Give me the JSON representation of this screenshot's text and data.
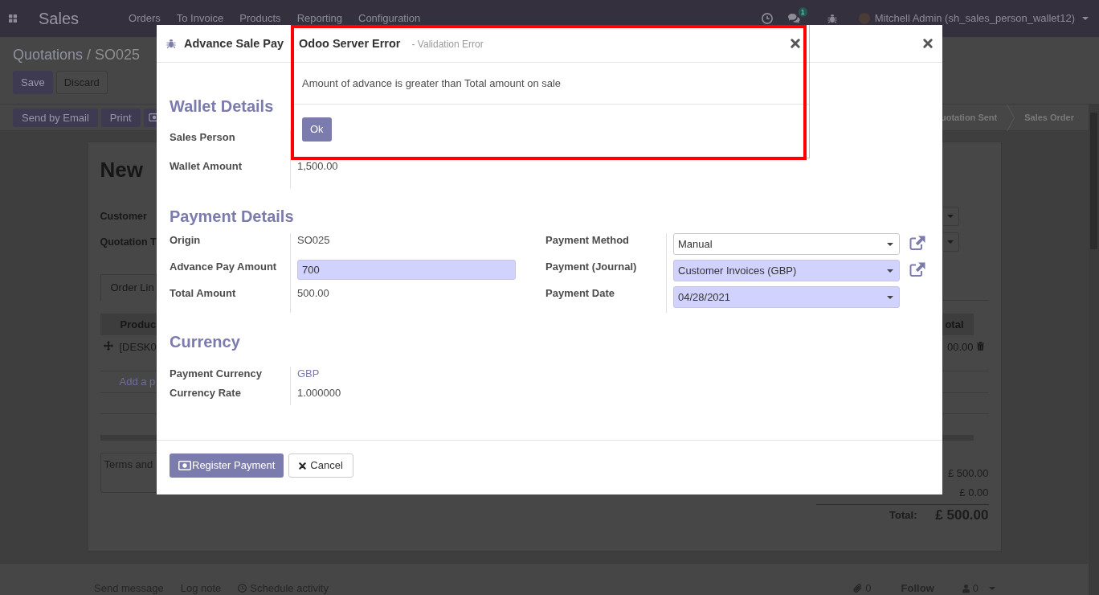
{
  "navbar": {
    "app_name": "Sales",
    "menu": [
      "Orders",
      "To Invoice",
      "Products",
      "Reporting",
      "Configuration"
    ],
    "chat_badge": "1",
    "user": "Mitchell Admin (sh_sales_person_wallet12)"
  },
  "control_panel": {
    "breadcrumb": [
      "Quotations",
      "SO025"
    ],
    "separator": "/",
    "buttons": [
      {
        "label": "Save",
        "kind": "primary"
      },
      {
        "label": "Discard",
        "kind": "secondary"
      }
    ]
  },
  "status_bar": {
    "buttons": [
      {
        "label": "Send by Email",
        "kind": "primary"
      },
      {
        "label": "Print",
        "kind": "primary"
      },
      {
        "kind": "icon"
      }
    ],
    "stages": [
      {
        "label": "uotation Sent",
        "selected": false
      },
      {
        "label": "Sales Order",
        "selected": false
      }
    ]
  },
  "form": {
    "title": "New",
    "fields": [
      {
        "label": "Customer"
      },
      {
        "label": "Quotation T"
      }
    ],
    "tabs": [
      {
        "label": "Order Lin",
        "selected": true
      }
    ],
    "table": {
      "columns": [
        "Produc",
        "otal"
      ],
      "rows": [
        [
          "[DESK0",
          "00.00"
        ]
      ],
      "add_line": "Add a p"
    },
    "notes_placeholder": "Terms and",
    "totals": [
      {
        "value": "£ 500.00",
        "kind": "subtotal"
      },
      {
        "value": "£ 0.00",
        "kind": "subtotal"
      },
      {
        "label": "Total:",
        "value": "£ 500.00",
        "kind": "total"
      }
    ]
  },
  "chatter": {
    "actions": [
      {
        "label": "Send message",
        "kind": "text"
      },
      {
        "label": "Log note",
        "kind": "text"
      },
      {
        "label": "Schedule activity",
        "kind": "activity"
      }
    ],
    "attachment_count": "0",
    "follow": "Follow",
    "follower_count": "0"
  },
  "dialog": {
    "title": "Advance Sale Pay",
    "sections": [
      {
        "title": "Wallet Details",
        "groups": [
          [
            {
              "label": "Sales Person",
              "kind": "text"
            },
            {
              "label": "Wallet Amount",
              "kind": "text",
              "value": "1,500.00"
            }
          ]
        ]
      },
      {
        "title": "Payment Details",
        "groups": [
          [
            {
              "label": "Origin",
              "kind": "text",
              "value": "SO025"
            },
            {
              "label": "Advance Pay Amount",
              "kind": "input",
              "value": "700",
              "required": true
            },
            {
              "label": "Total Amount",
              "kind": "text",
              "value": "500.00"
            }
          ],
          [
            {
              "label": "Payment Method",
              "kind": "select",
              "value": "Manual",
              "required": false,
              "open_link": true
            },
            {
              "label": "Payment (Journal)",
              "kind": "select",
              "value": "Customer Invoices (GBP)",
              "required": true,
              "open_link": true
            },
            {
              "label": "Payment Date",
              "kind": "select",
              "value": "04/28/2021",
              "required": true,
              "open_link": false
            }
          ]
        ]
      },
      {
        "title": "Currency",
        "groups": [
          [
            {
              "label": "Payment Currency",
              "kind": "link",
              "value": "GBP"
            },
            {
              "label": "Currency Rate",
              "kind": "text",
              "value": "1.000000"
            }
          ]
        ]
      }
    ],
    "buttons": [
      {
        "label": "Register Payment",
        "kind": "primary"
      },
      {
        "label": "Cancel",
        "kind": "secondary"
      }
    ]
  },
  "error_dialog": {
    "title": "Odoo Server Error",
    "subtitle": "- Validation Error",
    "message": "Amount of advance is greater than Total amount on sale",
    "button": "Ok"
  }
}
